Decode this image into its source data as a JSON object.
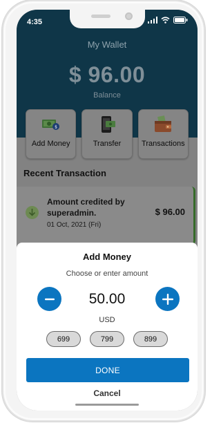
{
  "status_bar": {
    "time": "4:35"
  },
  "header": {
    "title": "My Wallet",
    "balance": "$ 96.00",
    "balance_label": "Balance"
  },
  "actions": [
    {
      "label": "Add Money",
      "icon": "money-bill-icon"
    },
    {
      "label": "Transfer",
      "icon": "phone-transfer-icon"
    },
    {
      "label": "Transactions",
      "icon": "wallet-icon"
    }
  ],
  "recent": {
    "title": "Recent Transaction",
    "items": [
      {
        "title": "Amount credited by superadmin.",
        "date": "01 Oct, 2021 (Fri)",
        "amount": "$ 96.00",
        "icon": "arrow-down-icon"
      }
    ]
  },
  "sheet": {
    "title": "Add Money",
    "subtitle": "Choose or enter amount",
    "amount": "50.00",
    "currency": "USD",
    "presets": [
      "699",
      "799",
      "899"
    ],
    "done_label": "DONE",
    "cancel_label": "Cancel"
  },
  "colors": {
    "primary": "#0b75c0",
    "header_bg": "#0f3648",
    "overlay": "#828282"
  }
}
